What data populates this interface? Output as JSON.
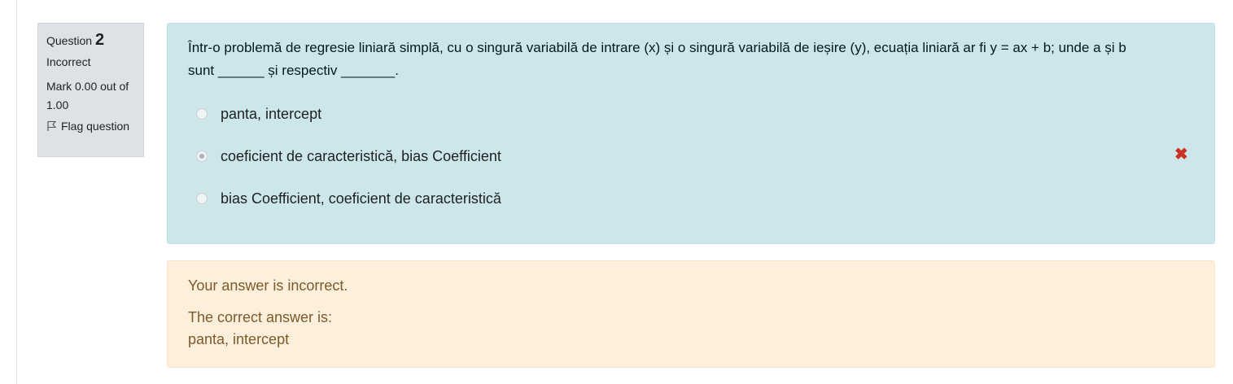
{
  "question": {
    "label": "Question",
    "number": "2",
    "state": "Incorrect",
    "grade": "Mark 0.00 out of 1.00",
    "flag_label": "Flag question",
    "text": "Într-o problemă de regresie liniară simplă, cu o singură variabilă de intrare (x) și o singură variabilă de ieșire (y), ecuația liniară ar fi y = ax + b; unde a și b sunt ______ și respectiv _______."
  },
  "answers": [
    {
      "label": "panta, intercept",
      "selected": false
    },
    {
      "label": "coeficient de caracteristică, bias Coefficient",
      "selected": true,
      "marked": "incorrect"
    },
    {
      "label": "bias Coefficient, coeficient de caracteristică",
      "selected": false
    }
  ],
  "feedback": {
    "general": "Your answer is incorrect.",
    "right_answer_label": "The correct answer is:",
    "right_answer_value": "panta, intercept"
  },
  "colors": {
    "formulation_bg": "#cce6ea",
    "feedback_bg": "#fcefdc",
    "info_bg": "#dee2e6",
    "incorrect_icon": "#ca3120"
  },
  "icons": {
    "flag": "flag-icon",
    "incorrect": "cross-icon"
  }
}
